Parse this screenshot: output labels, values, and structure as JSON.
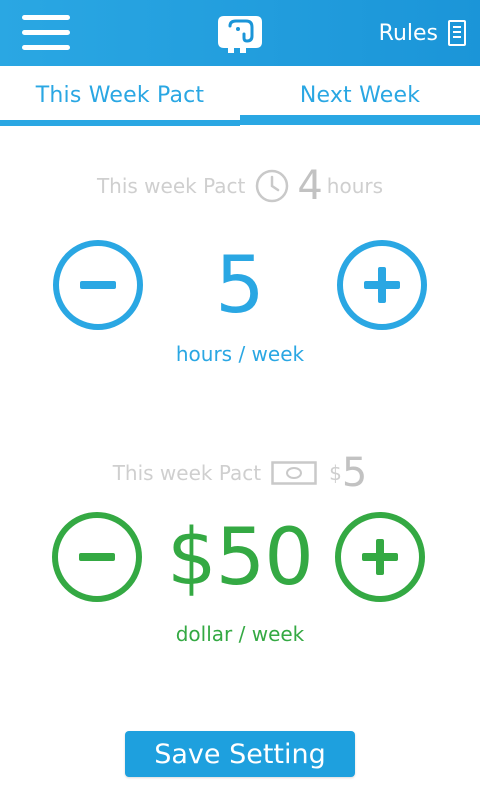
{
  "header": {
    "menu_icon": "hamburger-menu-icon",
    "logo_icon": "elephant-logo-icon",
    "rules_label": "Rules",
    "rules_icon": "document-icon"
  },
  "tabs": [
    {
      "label": "This Week Pact"
    },
    {
      "label": "Next Week",
      "selected": true
    }
  ],
  "hours": {
    "pact_label": "This week Pact",
    "pact_value": "4",
    "pact_unit": "hours",
    "value": "5",
    "unit_label": "hours / week"
  },
  "dollars": {
    "pact_label": "This week Pact",
    "pact_currency": "$",
    "pact_value": "5",
    "value": "$50",
    "unit_label": "dollar / week"
  },
  "save_button": "Save Setting",
  "colors": {
    "primary_blue": "#2aa7e3",
    "green": "#34a943",
    "muted_gray": "#c9c9c9"
  }
}
